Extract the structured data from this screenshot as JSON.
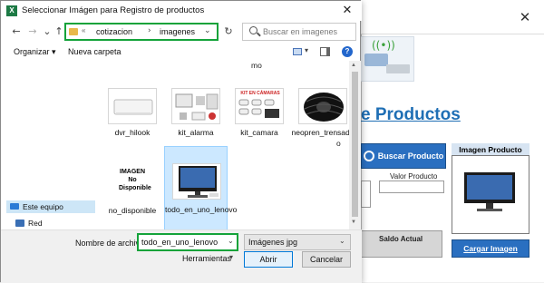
{
  "dialog": {
    "title": "Seleccionar Imágen para Registro de productos",
    "close_glyph": "✕",
    "nav": {
      "back": "←",
      "forward": "→",
      "down": "⌄",
      "up": "↑"
    },
    "address": {
      "separator": "«",
      "crumb1": "cotizacion",
      "chevron": "›",
      "crumb2": "imagenes",
      "dropdown": "⌄"
    },
    "refresh_glyph": "↻",
    "search": {
      "placeholder": "Buscar en imagenes"
    },
    "toolbar": {
      "organize": "Organizar ▾",
      "new_folder": "Nueva carpeta",
      "view_dropdown": "▾",
      "help": "?"
    },
    "nav_pane": {
      "items": [
        {
          "label": "Este equipo"
        },
        {
          "label": "Red"
        }
      ]
    },
    "fragments": {
      "top": "mo",
      "right": "o"
    },
    "files": [
      {
        "name": "dvr_hilook"
      },
      {
        "name": "kit_alarma"
      },
      {
        "name": "kit_camara"
      },
      {
        "name": "neopren_trensado"
      },
      {
        "name": "no_disponible"
      },
      {
        "name": "todo_en_uno_lenovo"
      }
    ],
    "thumb_texts": {
      "kit_camara": "KIT EN CÁMARAS",
      "no_disponible": "IMAGEN No Disponible"
    },
    "scrollbar": {
      "up": "▲",
      "down": "▼"
    },
    "bottom": {
      "file_name_label": "Nombre de archivo:",
      "file_name_value": "todo_en_uno_lenovo",
      "file_type": "Imágenes jpg",
      "dropdown": "⌄",
      "tools": "Herramientas",
      "tools_dropdown": "▾",
      "open": "Abrir",
      "cancel": "Cancelar"
    }
  },
  "background_app": {
    "close_glyph": "✕",
    "heading": "e Productos",
    "search_button": "Buscar Producto",
    "valor_label": "Valor Producto",
    "saldo_label": "Saldo Actual",
    "image_panel_title": "Imagen Producto",
    "load_button": "Cargar Imagen",
    "logo_wifi": "((•))"
  },
  "colors": {
    "highlight_green": "#14a33a",
    "brand_blue": "#1f6fb5",
    "button_blue": "#2a6fc0",
    "selection": "#cce8ff"
  }
}
